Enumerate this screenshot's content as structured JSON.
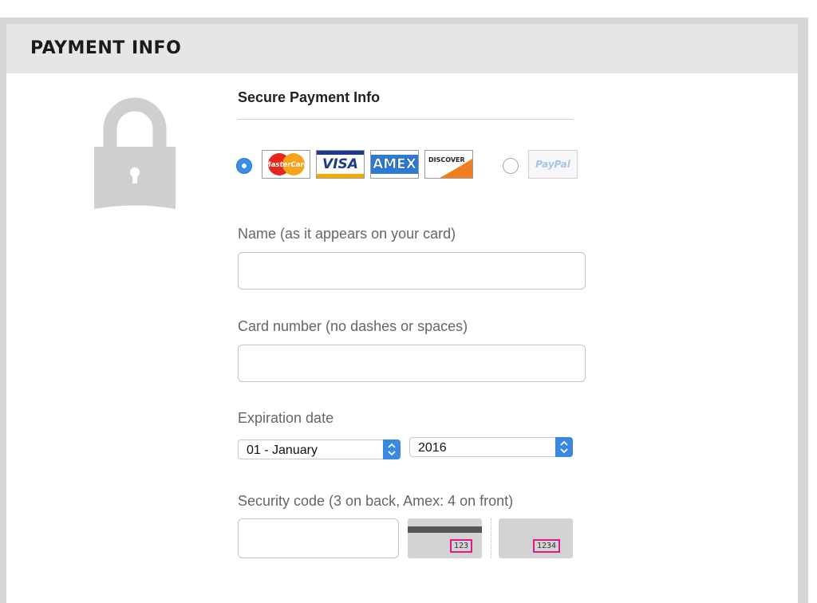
{
  "header": {
    "title": "PAYMENT INFO"
  },
  "section": {
    "title": "Secure Payment Info"
  },
  "payment_methods": {
    "cards": [
      {
        "name": "MasterCard",
        "icon": "mastercard-logo-icon"
      },
      {
        "name": "VISA",
        "icon": "visa-logo-icon"
      },
      {
        "name": "AMEX",
        "icon": "amex-logo-icon"
      },
      {
        "name": "DISCOVER",
        "icon": "discover-logo-icon"
      }
    ],
    "paypal": {
      "name": "PayPal",
      "icon": "paypal-logo-icon"
    },
    "selected": "cards"
  },
  "fields": {
    "name": {
      "label": "Name (as it appears on your card)",
      "value": "",
      "placeholder": ""
    },
    "card_number": {
      "label": "Card number (no dashes or spaces)",
      "value": "",
      "placeholder": ""
    },
    "expiration": {
      "label": "Expiration date",
      "month": "01 - January",
      "year": "2016"
    },
    "security": {
      "label": "Security code (3 on back, Amex: 4 on front)",
      "value": "",
      "placeholder": "",
      "back_example": "123",
      "front_example": "1234"
    }
  },
  "colors": {
    "header_bg": "#e6e6e6",
    "frame": "#d6d6d6",
    "accent": "#3a88e0",
    "cvv_highlight": "#e0198a"
  }
}
